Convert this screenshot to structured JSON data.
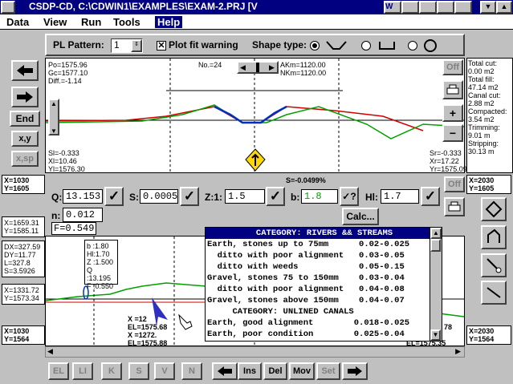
{
  "title": "CSDP-CD, C:\\CDWIN1\\EXAMPLES\\EXAM-2.PRJ [V",
  "menu": [
    "Data",
    "View",
    "Run",
    "Tools",
    "Help"
  ],
  "toolbar": {
    "pl_pattern_label": "PL Pattern:",
    "pl_pattern_value": "1",
    "plot_fit_label": "Plot fit warning",
    "shape_type_label": "Shape type:"
  },
  "profile": {
    "po": "Po=1575.96",
    "gc": "Gc=1577.10",
    "diff": "Diff.=-1.14",
    "no": "No.=24",
    "akm": "AKm=1120.00",
    "nkm": "NKm=1120.00",
    "sl": "Sl=-0.333",
    "xl": "Xl=10.46",
    "yl": "Yl=1576.30",
    "sr": "Sr=-0.333",
    "xr": "Xr=17.22",
    "yr": "Yr=1575.09"
  },
  "right_stats": [
    "Total cut:",
    "0.00 m2",
    "Total fill:",
    "47.14 m2",
    "Canal cut:",
    "2.88 m2",
    "Compacted:",
    "3.54 m2",
    "Trimming:",
    "9.01 m",
    "Stripping:",
    "30.13 m"
  ],
  "buttons": {
    "end": "End",
    "xy": "x,y",
    "xsp": "x,sp",
    "off": "Off",
    "off2": "Off",
    "plus": "+",
    "minus": "−",
    "calc": "Calc..."
  },
  "coords": {
    "x1": "X=1030",
    "y1": "Y=1605",
    "x2": "X=2030",
    "y2": "Y=1605",
    "x3": "X=1030",
    "y3": "Y=1564",
    "x4": "X=2030",
    "y4": "Y=1564"
  },
  "left_info": [
    "X=1659.31",
    "Y=1585.11"
  ],
  "dx_info": [
    "DX=327.59",
    "DY=11.77",
    "L=327.8",
    "S=3.5926"
  ],
  "bottom_left": [
    "X=1331.72",
    "Y=1573.34"
  ],
  "params": {
    "q_label": "Q:",
    "q": "13.153",
    "s_label": "S:",
    "s": "0.0005",
    "z_label": "Z:1:",
    "z": "1.5",
    "slope": "S=-0.0499%",
    "b_label": "b:",
    "b": "1.8",
    "hl_label": "Hl:",
    "hl": "1.7",
    "n_label": "n:",
    "n": "0.012",
    "f": "F=0.549"
  },
  "section_box": [
    "b :1.80",
    "Hl:1.70",
    "Z :1.500",
    "Q :13.195",
    "F :0.550"
  ],
  "section_labels": {
    "x": "X =12",
    "el": "EL=1575.68",
    "x2": "X =1272.",
    "el2": "EL=1575.88",
    "r1": "78",
    "r2": "EL=1575.35"
  },
  "roughness_list": [
    {
      "text": "CATEGORY: RIVERS && STREAMS",
      "hl": true
    },
    {
      "text": "Earth, stones up to 75mm      0.02-0.025"
    },
    {
      "text": "  ditto with poor alignment   0.03-0.05"
    },
    {
      "text": "  ditto with weeds            0.05-0.15"
    },
    {
      "text": "Gravel, stones 75 to 150mm    0.03-0.04"
    },
    {
      "text": "  ditto with poor alignment   0.04-0.08"
    },
    {
      "text": "Gravel, stones above 150mm    0.04-0.07"
    },
    {
      "text": "     CATEGORY: UNLINED CANALS"
    },
    {
      "text": "Earth, good alignment        0.018-0.025"
    },
    {
      "text": "Earth, poor condition        0.025-0.04"
    }
  ],
  "bottom_toolbar": [
    "EL",
    "LI",
    "K",
    "S",
    "V",
    "N",
    "Ins",
    "Del",
    "Mov",
    "Set"
  ]
}
